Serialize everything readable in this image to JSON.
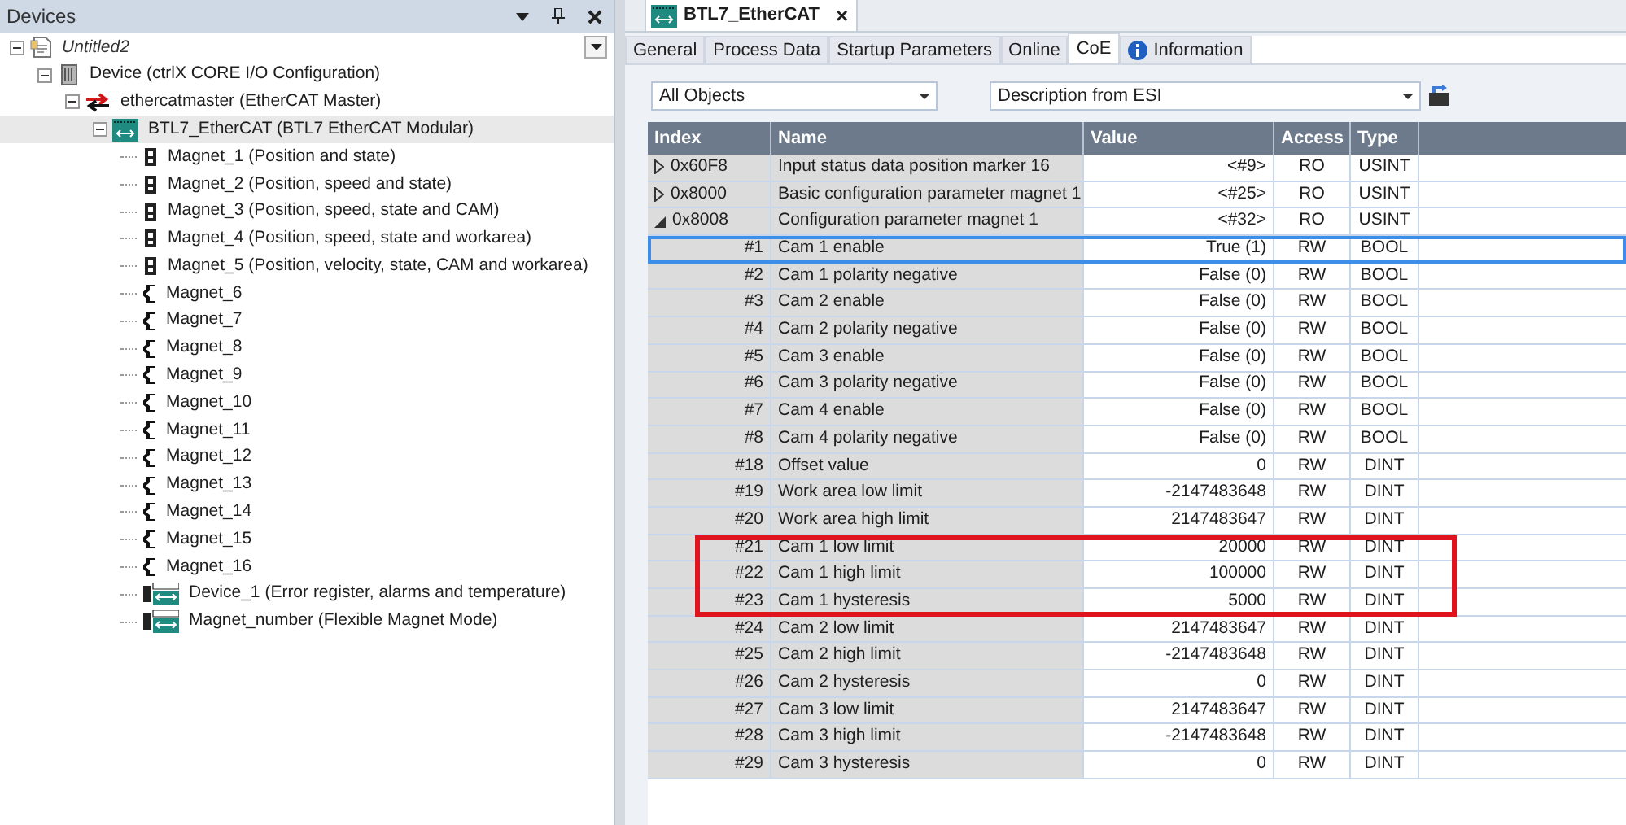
{
  "devices_panel": {
    "title": "Devices",
    "tree": [
      {
        "label": "Untitled2",
        "kind": "project",
        "expanded": true,
        "children": [
          {
            "label": "Device (ctrlX CORE I/O Configuration)",
            "kind": "device",
            "expanded": true,
            "children": [
              {
                "label": "ethercatmaster (EtherCAT Master)",
                "kind": "master",
                "expanded": true,
                "children": [
                  {
                    "label": "BTL7_EtherCAT (BTL7 EtherCAT Modular)",
                    "kind": "module",
                    "expanded": true,
                    "selected": true,
                    "children": [
                      {
                        "label": "Magnet_1 (Position and state)",
                        "kind": "magnet_configured",
                        "selected": false
                      },
                      {
                        "label": "Magnet_2 (Position, speed and state)",
                        "kind": "magnet_configured",
                        "selected": false
                      },
                      {
                        "label": "Magnet_3 (Position, speed, state and CAM)",
                        "kind": "magnet_configured",
                        "selected": false
                      },
                      {
                        "label": "Magnet_4 (Position, speed, state and workarea)",
                        "kind": "magnet_configured",
                        "selected": false
                      },
                      {
                        "label": "Magnet_5 (Position, velocity, state, CAM and workarea)",
                        "kind": "magnet_configured",
                        "selected": false
                      },
                      {
                        "label": "Magnet_6",
                        "kind": "magnet",
                        "selected": false
                      },
                      {
                        "label": "Magnet_7",
                        "kind": "magnet",
                        "selected": false
                      },
                      {
                        "label": "Magnet_8",
                        "kind": "magnet",
                        "selected": false
                      },
                      {
                        "label": "Magnet_9",
                        "kind": "magnet",
                        "selected": false
                      },
                      {
                        "label": "Magnet_10",
                        "kind": "magnet",
                        "selected": false
                      },
                      {
                        "label": "Magnet_11",
                        "kind": "magnet",
                        "selected": false
                      },
                      {
                        "label": "Magnet_12",
                        "kind": "magnet",
                        "selected": false
                      },
                      {
                        "label": "Magnet_13",
                        "kind": "magnet",
                        "selected": false
                      },
                      {
                        "label": "Magnet_14",
                        "kind": "magnet",
                        "selected": false
                      },
                      {
                        "label": "Magnet_15",
                        "kind": "magnet",
                        "selected": false
                      },
                      {
                        "label": "Magnet_16",
                        "kind": "magnet",
                        "selected": false
                      },
                      {
                        "label": "Device_1 (Error register, alarms and temperature)",
                        "kind": "submodule",
                        "selected": false
                      },
                      {
                        "label": "Magnet_number (Flexible Magnet Mode)",
                        "kind": "submodule",
                        "selected": false
                      }
                    ]
                  }
                ]
              }
            ]
          }
        ]
      }
    ]
  },
  "editor": {
    "document_tab": {
      "label": "BTL7_EtherCAT",
      "close": "×"
    },
    "tabs": [
      {
        "label": "General",
        "selected": false
      },
      {
        "label": "Process Data",
        "selected": false
      },
      {
        "label": "Startup Parameters",
        "selected": false
      },
      {
        "label": "Online",
        "selected": false
      },
      {
        "label": "CoE",
        "selected": true
      },
      {
        "label": "Information",
        "selected": false,
        "info": true
      }
    ],
    "filter": {
      "value": "All Objects"
    },
    "description": {
      "value": "Description from ESI"
    },
    "table": {
      "columns": [
        "Index",
        "Name",
        "Value",
        "Access",
        "Type"
      ],
      "rows": [
        {
          "index": "0x60F8",
          "name": "Input status data position marker 16",
          "value": "<#9>",
          "access": "RO",
          "type": "USINT",
          "expanded": false,
          "selected": false
        },
        {
          "index": "0x8000",
          "name": "Basic configuration parameter magnet 1",
          "value": "<#25>",
          "access": "RO",
          "type": "USINT",
          "expanded": false,
          "selected": false
        },
        {
          "index": "0x8008",
          "name": "Configuration parameter magnet 1",
          "value": "<#32>",
          "access": "RO",
          "type": "USINT",
          "expanded": true,
          "selected": false,
          "children": [
            {
              "index": "#1",
              "name": "Cam 1 enable",
              "value": "True (1)",
              "access": "RW",
              "type": "BOOL",
              "selected": true,
              "highlighted": false
            },
            {
              "index": "#2",
              "name": "Cam 1 polarity negative",
              "value": "False (0)",
              "access": "RW",
              "type": "BOOL",
              "selected": false,
              "highlighted": false
            },
            {
              "index": "#3",
              "name": "Cam 2 enable",
              "value": "False (0)",
              "access": "RW",
              "type": "BOOL",
              "selected": false,
              "highlighted": false
            },
            {
              "index": "#4",
              "name": "Cam 2 polarity negative",
              "value": "False (0)",
              "access": "RW",
              "type": "BOOL",
              "selected": false,
              "highlighted": false
            },
            {
              "index": "#5",
              "name": "Cam 3 enable",
              "value": "False (0)",
              "access": "RW",
              "type": "BOOL",
              "selected": false,
              "highlighted": false
            },
            {
              "index": "#6",
              "name": "Cam 3 polarity negative",
              "value": "False (0)",
              "access": "RW",
              "type": "BOOL",
              "selected": false,
              "highlighted": false
            },
            {
              "index": "#7",
              "name": "Cam 4 enable",
              "value": "False (0)",
              "access": "RW",
              "type": "BOOL",
              "selected": false,
              "highlighted": false
            },
            {
              "index": "#8",
              "name": "Cam 4 polarity negative",
              "value": "False (0)",
              "access": "RW",
              "type": "BOOL",
              "selected": false,
              "highlighted": false
            },
            {
              "index": "#18",
              "name": "Offset value",
              "value": "0",
              "access": "RW",
              "type": "DINT",
              "selected": false,
              "highlighted": false
            },
            {
              "index": "#19",
              "name": "Work area low limit",
              "value": "-2147483648",
              "access": "RW",
              "type": "DINT",
              "selected": false,
              "highlighted": false
            },
            {
              "index": "#20",
              "name": "Work area high limit",
              "value": "2147483647",
              "access": "RW",
              "type": "DINT",
              "selected": false,
              "highlighted": false
            },
            {
              "index": "#21",
              "name": "Cam 1 low limit",
              "value": "20000",
              "access": "RW",
              "type": "DINT",
              "selected": false,
              "highlighted": true
            },
            {
              "index": "#22",
              "name": "Cam 1 high limit",
              "value": "100000",
              "access": "RW",
              "type": "DINT",
              "selected": false,
              "highlighted": true
            },
            {
              "index": "#23",
              "name": "Cam 1 hysteresis",
              "value": "5000",
              "access": "RW",
              "type": "DINT",
              "selected": false,
              "highlighted": true
            },
            {
              "index": "#24",
              "name": "Cam 2 low limit",
              "value": "2147483647",
              "access": "RW",
              "type": "DINT",
              "selected": false,
              "highlighted": false
            },
            {
              "index": "#25",
              "name": "Cam 2 high limit",
              "value": "-2147483648",
              "access": "RW",
              "type": "DINT",
              "selected": false,
              "highlighted": false
            },
            {
              "index": "#26",
              "name": "Cam 2 hysteresis",
              "value": "0",
              "access": "RW",
              "type": "DINT",
              "selected": false,
              "highlighted": false
            },
            {
              "index": "#27",
              "name": "Cam 3 low limit",
              "value": "2147483647",
              "access": "RW",
              "type": "DINT",
              "selected": false,
              "highlighted": false
            },
            {
              "index": "#28",
              "name": "Cam 3 high limit",
              "value": "-2147483648",
              "access": "RW",
              "type": "DINT",
              "selected": false,
              "highlighted": false
            },
            {
              "index": "#29",
              "name": "Cam 3 hysteresis",
              "value": "0",
              "access": "RW",
              "type": "DINT",
              "selected": false,
              "highlighted": false
            }
          ]
        }
      ]
    }
  }
}
